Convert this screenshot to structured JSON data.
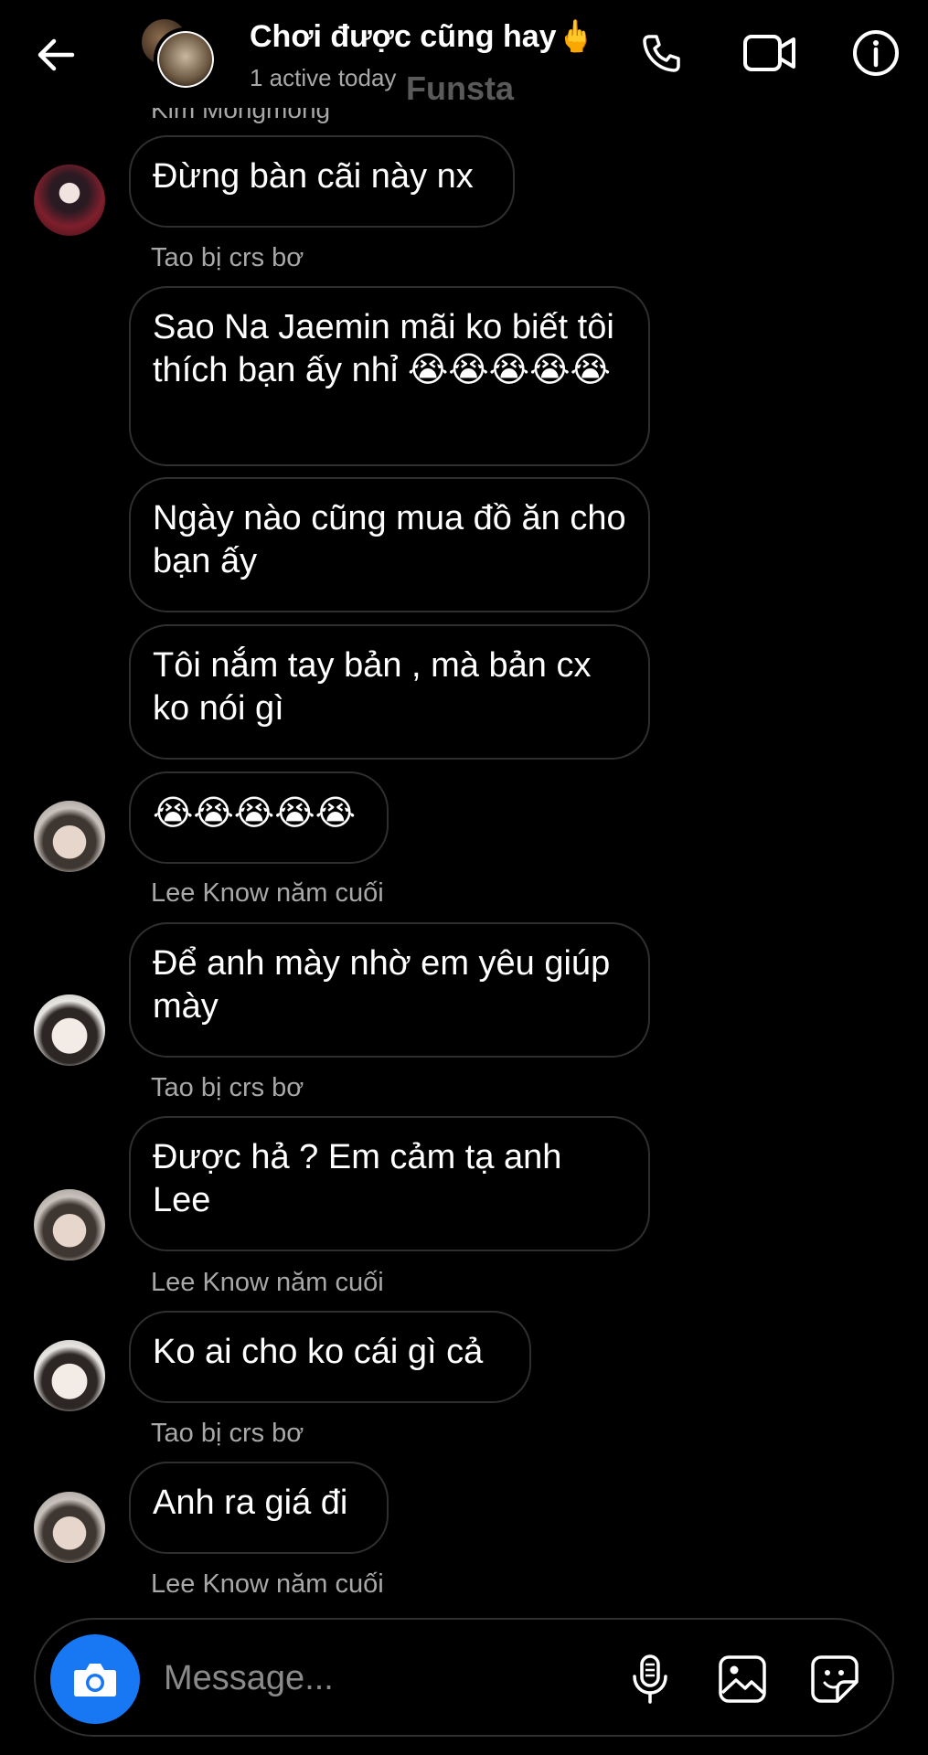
{
  "header": {
    "title": "Chơi được cũng hay🖕",
    "subtitle": "1 active today",
    "watermark": "Funsta",
    "icons": [
      "back-arrow-icon",
      "phone-icon",
      "video-camera-icon",
      "info-icon"
    ]
  },
  "cut_label": "Kim Mongmong",
  "messages": [
    {
      "text": "Đừng bàn cãi này nx",
      "avatar": "red-hair-avatar"
    },
    {
      "sender": "Tao bị crs bơ"
    },
    {
      "text": "Sao Na Jaemin mãi ko biết tôi thích bạn ấy nhỉ 😭😭😭😭😭"
    },
    {
      "text": "Ngày nào cũng mua đồ ăn cho bạn ấy"
    },
    {
      "text": "Tôi nắm tay bản , mà bản cx ko nói gì"
    },
    {
      "text": "😭😭😭😭😭",
      "avatar": "tao-avatar"
    },
    {
      "sender": "Lee Know năm cuối"
    },
    {
      "text": "Để anh mày nhờ em yêu giúp mày",
      "avatar": "lee-avatar"
    },
    {
      "sender": "Tao bị crs bơ"
    },
    {
      "text": "Được hả ? Em cảm tạ anh Lee",
      "avatar": "tao-avatar"
    },
    {
      "sender": "Lee Know năm cuối"
    },
    {
      "text": "Ko ai cho ko cái gì cả",
      "avatar": "lee-avatar"
    },
    {
      "sender": "Tao bị crs bơ"
    },
    {
      "text": "Anh ra giá đi",
      "avatar": "tao-avatar"
    },
    {
      "sender": "Lee Know năm cuối"
    }
  ],
  "composer": {
    "placeholder": "Message...",
    "icons": [
      "camera-icon",
      "microphone-icon",
      "gallery-icon",
      "sticker-icon"
    ]
  },
  "colors": {
    "background": "#000000",
    "bubble_border": "#2f2f2f",
    "secondary_text": "#a8a8a8",
    "camera_button": "#1877f2"
  }
}
